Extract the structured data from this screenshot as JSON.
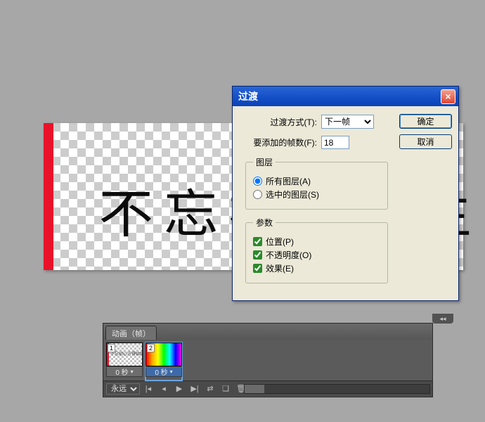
{
  "canvas": {
    "text_left": "不忘初",
    "text_right": "主"
  },
  "dialog": {
    "title": "过渡",
    "close_label": "×",
    "method_label": "过渡方式(T):",
    "method_selected": "下一帧",
    "frames_label": "要添加的帧数(F):",
    "frames_value": "18",
    "ok_label": "确定",
    "cancel_label": "取消",
    "layers_legend": "图层",
    "layers_all_label": "所有图层(A)",
    "layers_selected_label": "选中的图层(S)",
    "params_legend": "参数",
    "param_position_label": "位置(P)",
    "param_opacity_label": "不透明度(O)",
    "param_effects_label": "效果(E)"
  },
  "animation": {
    "flyout": "◂◂",
    "tab_label": "动画（帧）",
    "frames": [
      {
        "number": "1",
        "delay": "0 秒",
        "thumb": "frame1",
        "selected": false
      },
      {
        "number": "2",
        "delay": "0 秒",
        "thumb": "frame2",
        "selected": true
      }
    ],
    "loop_label": "永远",
    "controls": {
      "first": "|◂",
      "prev": "◂",
      "play": "▶",
      "next": "▶|",
      "tween": "⇄",
      "new": "❏",
      "delete": "🗑",
      "more": "≡"
    }
  }
}
